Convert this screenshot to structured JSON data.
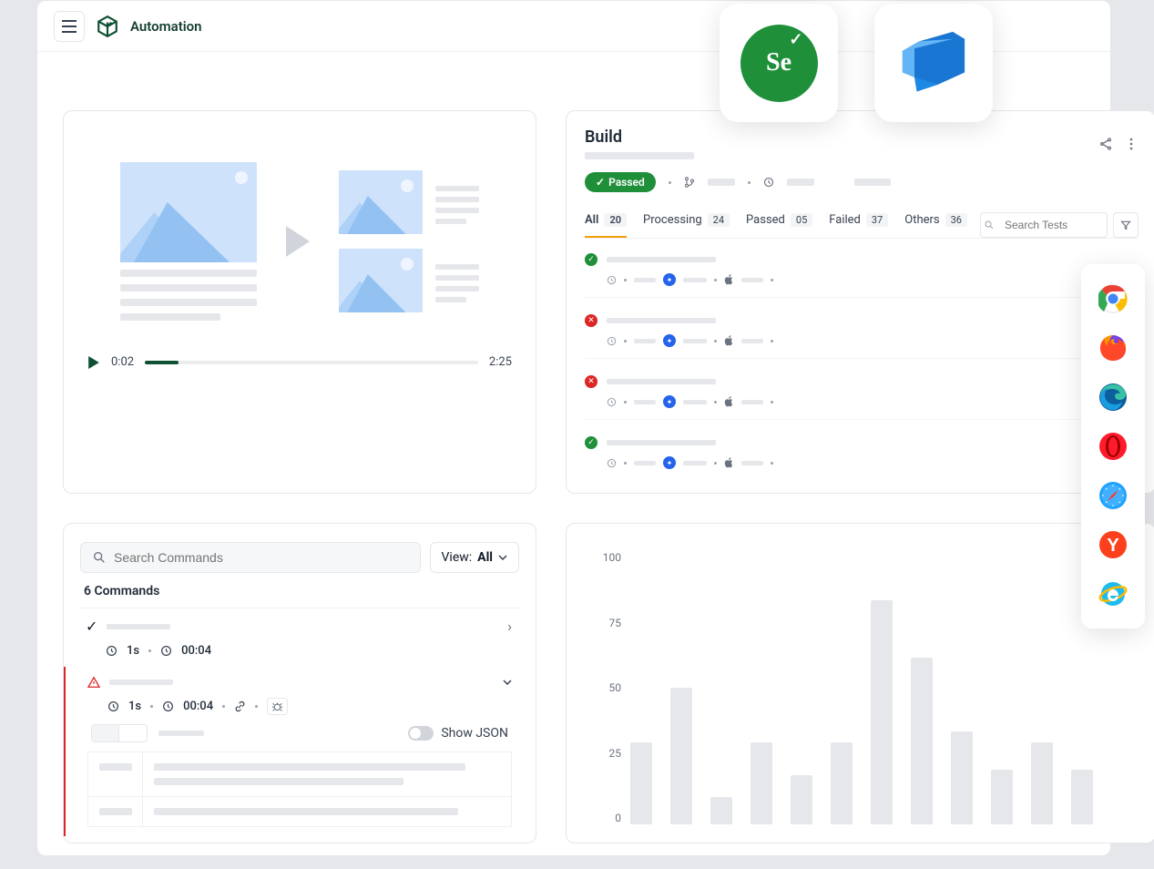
{
  "app": {
    "title": "Automation"
  },
  "video": {
    "current_time": "0:02",
    "total_time": "2:25",
    "progress_pct": 10
  },
  "build": {
    "title": "Build",
    "status_label": "Passed",
    "tabs": [
      {
        "label": "All",
        "count": "20",
        "active": true
      },
      {
        "label": "Processing",
        "count": "24",
        "active": false
      },
      {
        "label": "Passed",
        "count": "05",
        "active": false
      },
      {
        "label": "Failed",
        "count": "37",
        "active": false
      },
      {
        "label": "Others",
        "count": "36",
        "active": false
      }
    ],
    "search_placeholder": "Search Tests",
    "tests": [
      {
        "status": "passed"
      },
      {
        "status": "failed"
      },
      {
        "status": "failed"
      },
      {
        "status": "passed"
      }
    ]
  },
  "commands": {
    "search_placeholder": "Search Commands",
    "view_prefix": "View:",
    "view_value": "All",
    "count_label": "6 Commands",
    "show_json_label": "Show JSON",
    "items": [
      {
        "state": "ok",
        "duration1": "1s",
        "duration2": "00:04"
      },
      {
        "state": "warn",
        "duration1": "1s",
        "duration2": "00:04"
      }
    ]
  },
  "chart_data": {
    "type": "bar",
    "y_ticks": [
      100,
      75,
      50,
      25,
      0
    ],
    "values": [
      30,
      50,
      10,
      30,
      18,
      30,
      82,
      61,
      34,
      20,
      30,
      20
    ],
    "ylim": [
      0,
      100
    ]
  },
  "browsers": [
    "chrome",
    "firefox",
    "edge",
    "opera",
    "safari",
    "yandex",
    "ie"
  ],
  "integrations": {
    "selenium": "Se",
    "azure_devops": "Azure DevOps"
  }
}
